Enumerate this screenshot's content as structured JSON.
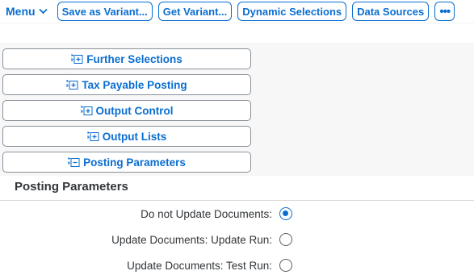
{
  "toolbar": {
    "menu_label": "Menu",
    "buttons": {
      "save_variant": "Save as Variant...",
      "get_variant": "Get Variant...",
      "dynamic_selections": "Dynamic Selections",
      "data_sources": "Data Sources",
      "more": "•••"
    }
  },
  "sections": [
    {
      "label": "Further Selections",
      "icon": "expand-section-icon"
    },
    {
      "label": "Tax Payable Posting",
      "icon": "expand-section-icon"
    },
    {
      "label": "Output Control",
      "icon": "expand-section-icon"
    },
    {
      "label": "Output Lists",
      "icon": "expand-section-icon"
    },
    {
      "label": "Posting Parameters",
      "icon": "collapse-section-icon"
    }
  ],
  "posting_parameters": {
    "title": "Posting Parameters",
    "options": [
      {
        "label": "Do not Update Documents:",
        "selected": true
      },
      {
        "label": "Update Documents: Update Run:",
        "selected": false
      },
      {
        "label": "Update Documents: Test Run:",
        "selected": false
      }
    ]
  },
  "colors": {
    "accent": "#0a6ed1",
    "panel_background": "#f7f7f7",
    "text": "#32363a"
  }
}
